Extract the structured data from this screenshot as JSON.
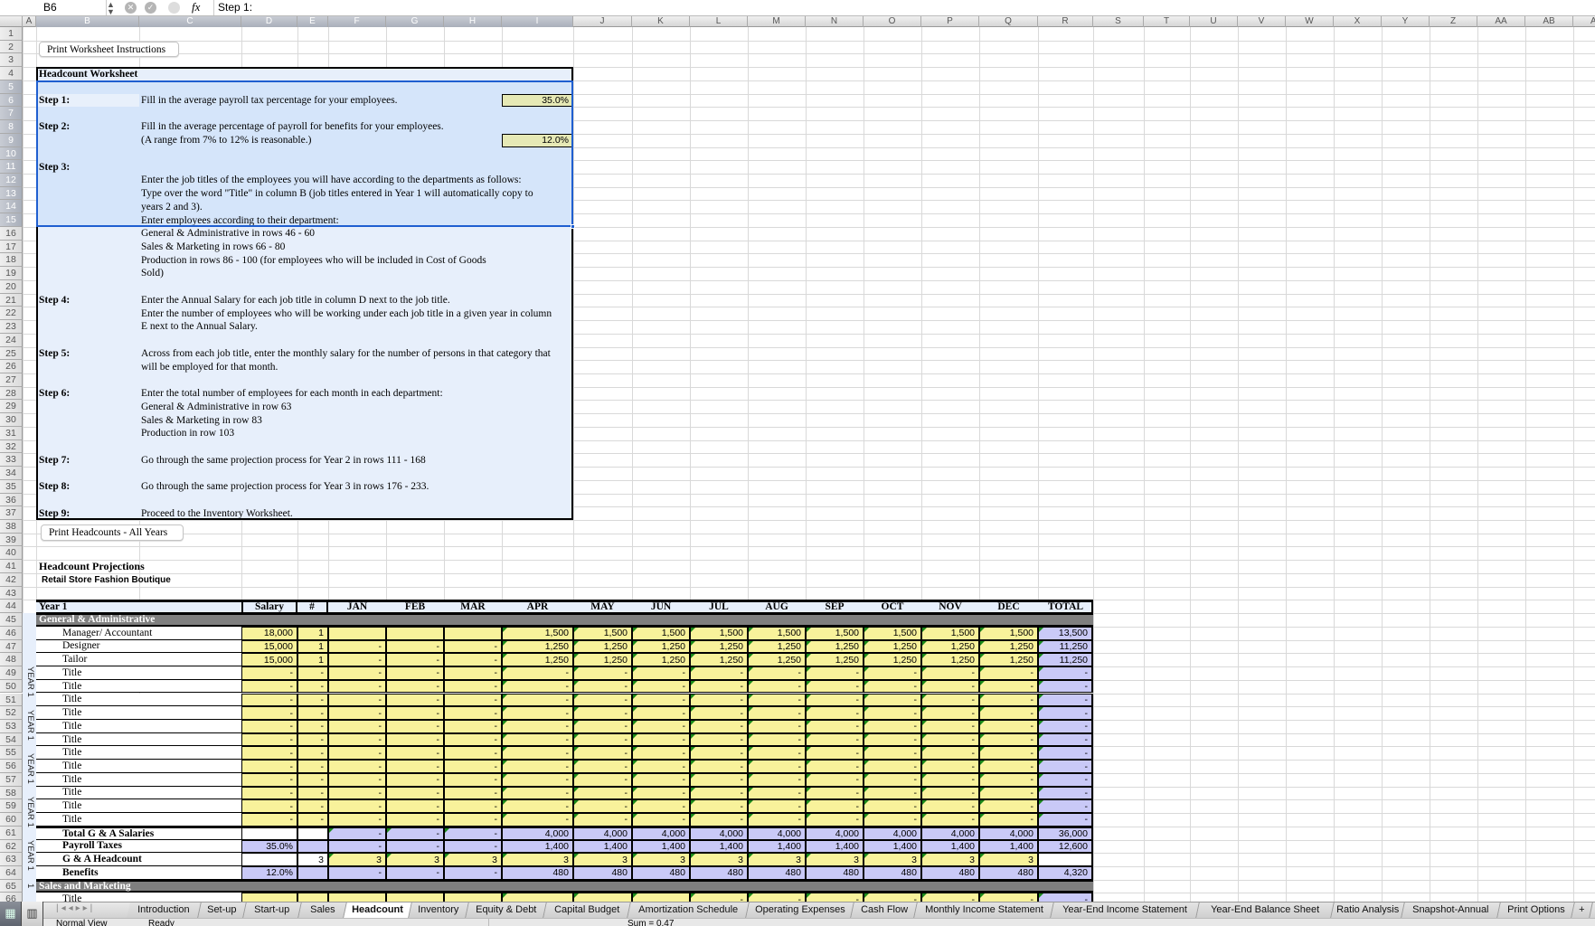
{
  "formula_bar": {
    "cell_ref": "B6",
    "fx_label": "fx",
    "formula": "Step 1:"
  },
  "columns": [
    "A",
    "B",
    "C",
    "D",
    "E",
    "F",
    "G",
    "H",
    "I",
    "J",
    "K",
    "L",
    "M",
    "N",
    "O",
    "P",
    "Q",
    "R",
    "S",
    "T",
    "U",
    "V",
    "W",
    "X",
    "Y",
    "Z",
    "AA",
    "AB",
    "AC"
  ],
  "row_headers": [
    1,
    2,
    3,
    4,
    5,
    6,
    7,
    8,
    9,
    10,
    11,
    12,
    13,
    14,
    15,
    16,
    17,
    18,
    19,
    20,
    21,
    22,
    23,
    24,
    25,
    26,
    27,
    28,
    29,
    30,
    31,
    32,
    33,
    34,
    35,
    36,
    37,
    38,
    39,
    40,
    41,
    42,
    43,
    44,
    45,
    46,
    47,
    48,
    49,
    50,
    51,
    52,
    53,
    54,
    55,
    56,
    57,
    58,
    59,
    60,
    61,
    62,
    63,
    64,
    65,
    66
  ],
  "buttons": {
    "print_instructions": "Print Worksheet Instructions",
    "print_headcounts": "Print Headcounts - All Years"
  },
  "instructions": {
    "title": "Headcount Worksheet",
    "payroll_tax": "35.0%",
    "benefits": "12.0%",
    "steps": [
      {
        "label": "Step 1:",
        "lines": [
          "Fill in the average payroll tax percentage for your employees."
        ]
      },
      {
        "label": "Step 2:",
        "lines": [
          "Fill in the average percentage of payroll for benefits for your employees.",
          "(A range from 7% to 12% is reasonable.)"
        ]
      },
      {
        "label": "Step 3:",
        "lines": [
          "Enter the job titles of the employees you will have according to the departments as follows:",
          "Type over the word \"Title\" in column B (job titles entered in Year 1 will automatically copy to",
          "years 2 and 3).",
          "Enter employees according to their department:",
          "General & Administrative in rows 46 - 60",
          "Sales & Marketing in rows 66 - 80",
          "Production in rows 86 - 100 (for employees who will be included in Cost of Goods",
          "Sold)"
        ]
      },
      {
        "label": "Step 4:",
        "lines": [
          "Enter the Annual Salary for each job title in column D next to the job title.",
          "Enter the number of employees who will be working under each job title in a given year in column",
          "E next to the Annual Salary."
        ]
      },
      {
        "label": "Step 5:",
        "lines": [
          "Across from each job title, enter the monthly salary for the number of persons in that category that",
          "will be employed for that month."
        ]
      },
      {
        "label": "Step 6:",
        "lines": [
          "Enter the total number of employees for each month in each department:",
          "General & Administrative in row 63",
          "Sales & Marketing in row 83",
          "Production in row 103"
        ]
      },
      {
        "label": "Step 7:",
        "lines": [
          "Go through the same projection process for Year 2 in rows 111 - 168"
        ]
      },
      {
        "label": "Step 8:",
        "lines": [
          "Go through the same projection process for Year 3 in rows 176 - 233."
        ]
      },
      {
        "label": "Step 9:",
        "lines": [
          "Proceed to the Inventory Worksheet."
        ]
      }
    ]
  },
  "projections": {
    "title": "Headcount Projections",
    "subtitle": "Retail Store Fashion Boutique"
  },
  "table": {
    "year_label": "Year 1",
    "side_label": "YEAR 1",
    "salary_header": "Salary",
    "count_header": "#",
    "total_header": "TOTAL",
    "months": [
      "JAN",
      "FEB",
      "MAR",
      "APR",
      "MAY",
      "JUN",
      "JUL",
      "AUG",
      "SEP",
      "OCT",
      "NOV",
      "DEC"
    ],
    "section_ga": "General & Administrative",
    "section_sm": "Sales and Marketing",
    "ga_rows": [
      {
        "kind": "job",
        "label": "Manager/ Accountant",
        "salary": "18,000",
        "count": "1",
        "months": [
          "",
          "",
          "",
          "1,500",
          "1,500",
          "1,500",
          "1,500",
          "1,500",
          "1,500",
          "1,500",
          "1,500",
          "1,500"
        ],
        "total": "13,500"
      },
      {
        "kind": "job",
        "label": "Designer",
        "salary": "15,000",
        "count": "1",
        "months": [
          "-",
          "-",
          "-",
          "1,250",
          "1,250",
          "1,250",
          "1,250",
          "1,250",
          "1,250",
          "1,250",
          "1,250",
          "1,250"
        ],
        "total": "11,250"
      },
      {
        "kind": "job",
        "label": "Tailor",
        "salary": "15,000",
        "count": "1",
        "months": [
          "-",
          "-",
          "-",
          "1,250",
          "1,250",
          "1,250",
          "1,250",
          "1,250",
          "1,250",
          "1,250",
          "1,250",
          "1,250"
        ],
        "total": "11,250"
      },
      {
        "kind": "job",
        "label": "Title",
        "salary": "-",
        "count": "-",
        "months": [
          "-",
          "-",
          "-",
          "-",
          "-",
          "-",
          "-",
          "-",
          "-",
          "-",
          "-",
          "-"
        ],
        "total": "-"
      },
      {
        "kind": "job",
        "label": "Title",
        "salary": "-",
        "count": "-",
        "months": [
          "-",
          "-",
          "-",
          "-",
          "-",
          "-",
          "-",
          "-",
          "-",
          "-",
          "-",
          "-"
        ],
        "total": "-"
      },
      {
        "kind": "job",
        "label": "Title",
        "salary": "-",
        "count": "-",
        "months": [
          "-",
          "-",
          "-",
          "-",
          "-",
          "-",
          "-",
          "-",
          "-",
          "-",
          "-",
          "-"
        ],
        "total": "-"
      },
      {
        "kind": "job",
        "label": "Title",
        "salary": "-",
        "count": "-",
        "months": [
          "-",
          "-",
          "-",
          "-",
          "-",
          "-",
          "-",
          "-",
          "-",
          "-",
          "-",
          "-"
        ],
        "total": "-"
      },
      {
        "kind": "job",
        "label": "Title",
        "salary": "-",
        "count": "-",
        "months": [
          "-",
          "-",
          "-",
          "-",
          "-",
          "-",
          "-",
          "-",
          "-",
          "-",
          "-",
          "-"
        ],
        "total": "-"
      },
      {
        "kind": "job",
        "label": "Title",
        "salary": "-",
        "count": "-",
        "months": [
          "-",
          "-",
          "-",
          "-",
          "-",
          "-",
          "-",
          "-",
          "-",
          "-",
          "-",
          "-"
        ],
        "total": "-"
      },
      {
        "kind": "job",
        "label": "Title",
        "salary": "-",
        "count": "-",
        "months": [
          "-",
          "-",
          "-",
          "-",
          "-",
          "-",
          "-",
          "-",
          "-",
          "-",
          "-",
          "-"
        ],
        "total": "-"
      },
      {
        "kind": "job",
        "label": "Title",
        "salary": "-",
        "count": "-",
        "months": [
          "-",
          "-",
          "-",
          "-",
          "-",
          "-",
          "-",
          "-",
          "-",
          "-",
          "-",
          "-"
        ],
        "total": "-"
      },
      {
        "kind": "job",
        "label": "Title",
        "salary": "-",
        "count": "-",
        "months": [
          "-",
          "-",
          "-",
          "-",
          "-",
          "-",
          "-",
          "-",
          "-",
          "-",
          "-",
          "-"
        ],
        "total": "-"
      },
      {
        "kind": "job",
        "label": "Title",
        "salary": "-",
        "count": "-",
        "months": [
          "-",
          "-",
          "-",
          "-",
          "-",
          "-",
          "-",
          "-",
          "-",
          "-",
          "-",
          "-"
        ],
        "total": "-"
      },
      {
        "kind": "job",
        "label": "Title",
        "salary": "-",
        "count": "-",
        "months": [
          "-",
          "-",
          "-",
          "-",
          "-",
          "-",
          "-",
          "-",
          "-",
          "-",
          "-",
          "-"
        ],
        "total": "-"
      },
      {
        "kind": "job",
        "label": "Title",
        "salary": "-",
        "count": "-",
        "months": [
          "-",
          "-",
          "-",
          "-",
          "-",
          "-",
          "-",
          "-",
          "-",
          "-",
          "-",
          "-"
        ],
        "total": "-"
      },
      {
        "kind": "total",
        "label": "Total G & A Salaries",
        "salary": "",
        "count": "",
        "months": [
          "-",
          "-",
          "-",
          "4,000",
          "4,000",
          "4,000",
          "4,000",
          "4,000",
          "4,000",
          "4,000",
          "4,000",
          "4,000"
        ],
        "total": "36,000"
      },
      {
        "kind": "tax",
        "label": "Payroll Taxes",
        "salary": "35.0%",
        "count": "",
        "months": [
          "-",
          "-",
          "-",
          "1,400",
          "1,400",
          "1,400",
          "1,400",
          "1,400",
          "1,400",
          "1,400",
          "1,400",
          "1,400"
        ],
        "total": "12,600"
      },
      {
        "kind": "headcount",
        "label": "G & A Headcount",
        "salary": "",
        "count": "3",
        "months": [
          "3",
          "3",
          "3",
          "3",
          "3",
          "3",
          "3",
          "3",
          "3",
          "3",
          "3",
          "3"
        ],
        "total": ""
      },
      {
        "kind": "benefits",
        "label": "Benefits",
        "salary": "12.0%",
        "count": "",
        "months": [
          "-",
          "-",
          "-",
          "480",
          "480",
          "480",
          "480",
          "480",
          "480",
          "480",
          "480",
          "480"
        ],
        "total": "4,320"
      }
    ],
    "sm_rows": [
      {
        "kind": "job",
        "label": "Title",
        "salary": "",
        "count": "",
        "months": [
          "",
          "",
          "",
          "",
          "",
          "",
          "-",
          "-",
          "-",
          "-",
          "-",
          "-"
        ],
        "total": "-"
      }
    ]
  },
  "sheet_tabs": [
    "Introduction",
    "Set-up",
    "Start-up",
    "Sales",
    "Headcount",
    "Inventory",
    "Equity & Debt",
    "Capital Budget",
    "Amortization Schedule",
    "Operating Expenses",
    "Cash Flow",
    "Monthly Income Statement",
    "Year-End Income Statement",
    "Year-End Balance Sheet",
    "Ratio Analysis",
    "Snapshot-Annual",
    "Print Options",
    "+"
  ],
  "active_tab": "Headcount",
  "status": {
    "view": "Normal View",
    "state": "Ready",
    "sum": "Sum = 0.47"
  },
  "colors": {
    "input_yellow": "#f8f29b",
    "formula_lavender": "#c9c9f7",
    "section_gray": "#7f7f7f",
    "instruction_blue": "#e7effb",
    "selection_blue": "#1f5fd0",
    "rate_input": "#e6e9b5",
    "error_triangle": "#1a8a1a"
  }
}
